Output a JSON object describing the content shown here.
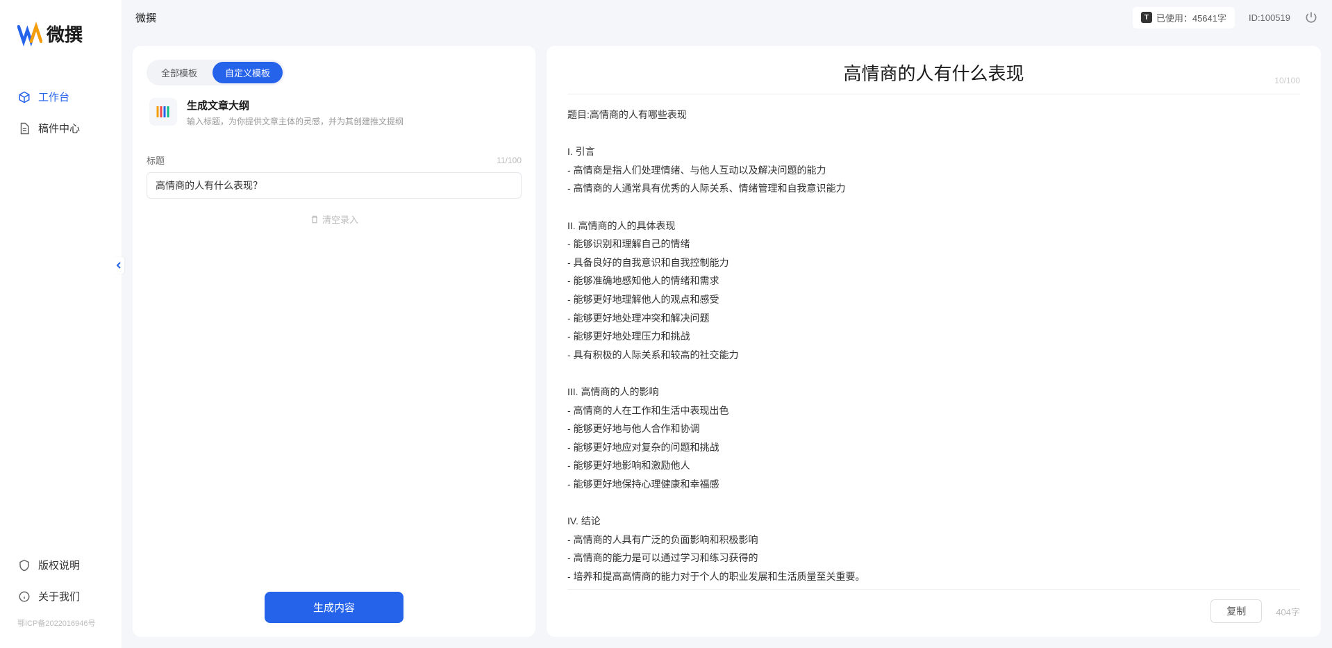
{
  "app": {
    "name": "微撰",
    "logoText": "微撰"
  },
  "sidebar": {
    "nav": [
      {
        "label": "工作台",
        "icon": "cube"
      },
      {
        "label": "稿件中心",
        "icon": "doc"
      }
    ],
    "bottom": [
      {
        "label": "版权说明",
        "icon": "shield"
      },
      {
        "label": "关于我们",
        "icon": "info"
      }
    ],
    "icp": "鄂ICP备2022016946号"
  },
  "topbar": {
    "title": "微撰",
    "usageLabel": "已使用：45641字",
    "userId": "ID:100519"
  },
  "leftPanel": {
    "tabs": [
      {
        "label": "全部模板"
      },
      {
        "label": "自定义模板"
      }
    ],
    "template": {
      "title": "生成文章大纲",
      "desc": "输入标题，为你提供文章主体的灵感，并为其创建推文提纲"
    },
    "form": {
      "titleLabel": "标题",
      "titleCounter": "11/100",
      "titleValue": "高情商的人有什么表现？",
      "clearLabel": "清空录入"
    },
    "generateLabel": "生成内容"
  },
  "rightPanel": {
    "title": "高情商的人有什么表现",
    "titleCounter": "10/100",
    "body": "题目:高情商的人有哪些表现\n\nI. 引言\n- 高情商是指人们处理情绪、与他人互动以及解决问题的能力\n- 高情商的人通常具有优秀的人际关系、情绪管理和自我意识能力\n\nII. 高情商的人的具体表现\n- 能够识别和理解自己的情绪\n- 具备良好的自我意识和自我控制能力\n- 能够准确地感知他人的情绪和需求\n- 能够更好地理解他人的观点和感受\n- 能够更好地处理冲突和解决问题\n- 能够更好地处理压力和挑战\n- 具有积极的人际关系和较高的社交能力\n\nIII. 高情商的人的影响\n- 高情商的人在工作和生活中表现出色\n- 能够更好地与他人合作和协调\n- 能够更好地应对复杂的问题和挑战\n- 能够更好地影响和激励他人\n- 能够更好地保持心理健康和幸福感\n\nIV. 结论\n- 高情商的人具有广泛的负面影响和积极影响\n- 高情商的能力是可以通过学习和练习获得的\n- 培养和提高高情商的能力对于个人的职业发展和生活质量至关重要。",
    "copyLabel": "复制",
    "wordCount": "404字"
  }
}
